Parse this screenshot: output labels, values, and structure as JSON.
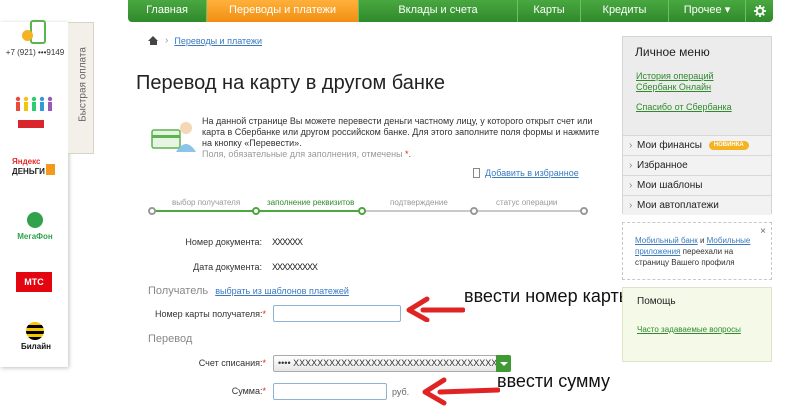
{
  "nav": {
    "tabs": [
      "Главная",
      "Переводы и платежи",
      "Вклады и счета",
      "Карты",
      "Кредиты",
      "Прочее ▾"
    ],
    "settings_icon": "gear-icon",
    "active_tab": "Переводы и платежи"
  },
  "quickpay": {
    "title": "Быстрая оплата",
    "phone": "+7 (921) •••9149",
    "yandex": "Яндекс",
    "yandex_money": "ДЕНЬГИ",
    "megafon": "МегаФон",
    "mts": "МТС",
    "beeline": "Билайн"
  },
  "breadcrumb": {
    "link": "Переводы и платежи"
  },
  "page_title": "Перевод на карту в другом банке",
  "intro": {
    "text": "На данной странице Вы можете перевести деньги частному лицу, у которого открыт счет или карта в Сбербанке или другом российском банке. Для этого заполните поля формы и нажмите на кнопку «Перевести».",
    "required_note": "Поля, обязательные для заполнения, отмечены",
    "star": "*."
  },
  "favorites_link": "Добавить в избранное",
  "steps": [
    "выбор получателя",
    "заполнение реквизитов",
    "подтверждение",
    "статус операции"
  ],
  "form": {
    "doc_number_label": "Номер документа:",
    "doc_number_value": "XXXXXX",
    "doc_date_label": "Дата документа:",
    "doc_date_value": "XXXXXXXXX",
    "recipient_section": "Получатель",
    "templates_link": "выбрать из шаблонов платежей",
    "card_number_label": "Номер карты получателя:",
    "card_number_value": "",
    "transfer_section": "Перевод",
    "account_label": "Счет списания:",
    "account_value": "•••• XXXXXXXXXXXXXXXXXXXXXXXXXXXXXXXXXXXXXXXX",
    "amount_label": "Сумма:",
    "amount_value": "",
    "currency": "руб.",
    "required_mark": "*"
  },
  "annotations": {
    "card_hint": "ввести номер карты",
    "amount_hint": "ввести сумму",
    "arrow_color": "#e02323"
  },
  "personal_menu": {
    "title": "Личное меню",
    "links": [
      "История операций Сбербанк Онлайн",
      "Спасибо от Сбербанка"
    ],
    "items": [
      "Мои финансы",
      "Избранное",
      "Мои шаблоны",
      "Мои автоплатежи"
    ],
    "new_badge": "НОВИНКА"
  },
  "mobile_promo": {
    "link1": "Мобильный банк",
    "and": "и",
    "link2": "Мобильные приложения",
    "rest": "переехали на страницу Вашего профиля",
    "close": "×"
  },
  "help": {
    "title": "Помощь",
    "link": "Часто задаваемые вопросы"
  },
  "colors": {
    "brand_green": "#2f8a2b",
    "active_orange": "#f08e12",
    "link_blue": "#3a7abf"
  }
}
